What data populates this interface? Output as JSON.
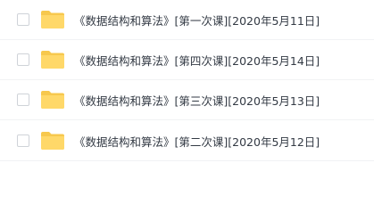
{
  "files": [
    {
      "name": "《数据结构和算法》[第一次课][2020年5月11日]",
      "icon": "folder-icon"
    },
    {
      "name": "《数据结构和算法》[第四次课][2020年5月14日]",
      "icon": "folder-icon"
    },
    {
      "name": "《数据结构和算法》[第三次课][2020年5月13日]",
      "icon": "folder-icon"
    },
    {
      "name": "《数据结构和算法》[第二次课][2020年5月12日]",
      "icon": "folder-icon"
    }
  ],
  "colors": {
    "folder": "#ffd869",
    "folder_tab": "#f7c84d",
    "text": "#333a44",
    "divider": "#f1f2f4"
  }
}
